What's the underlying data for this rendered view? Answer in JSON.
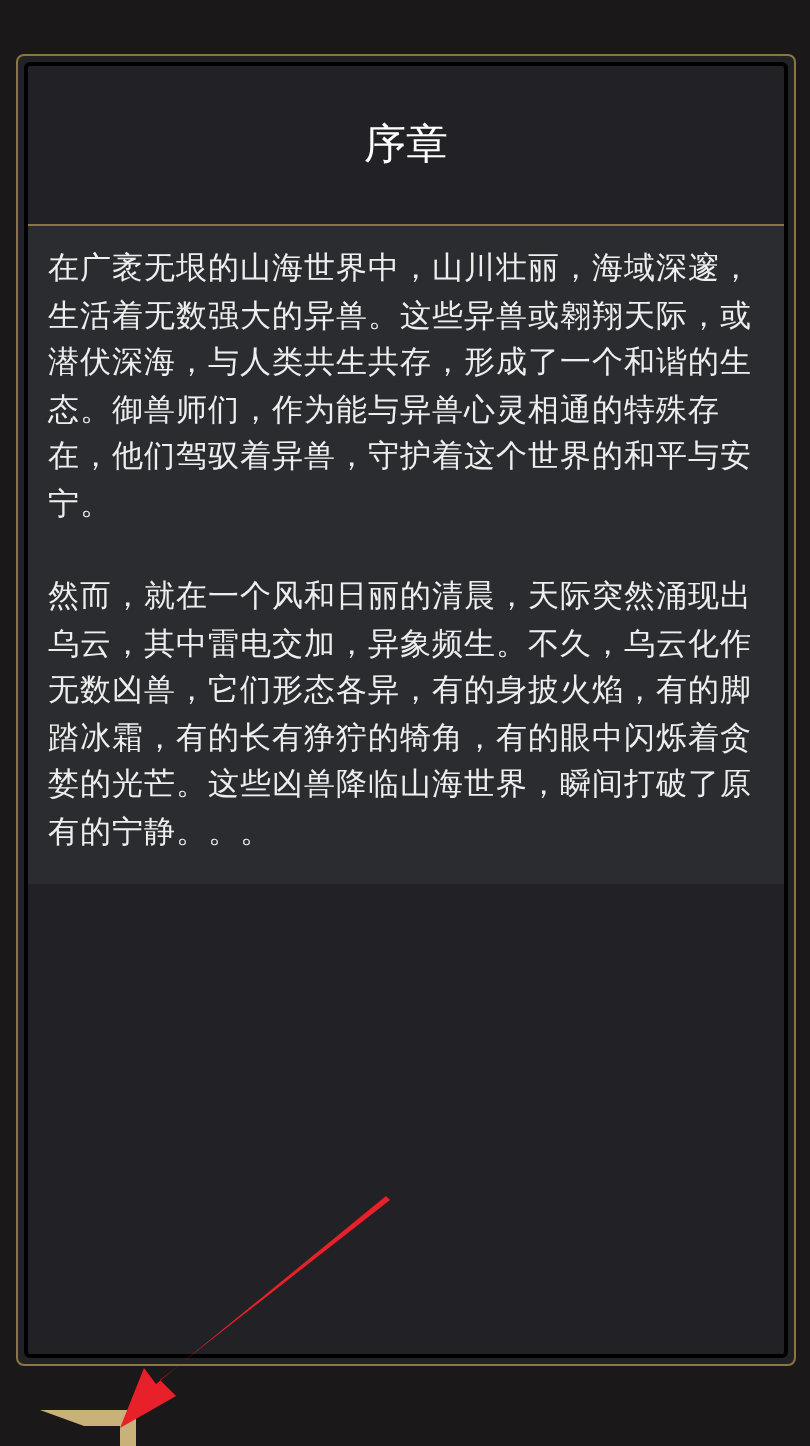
{
  "dialog": {
    "title": "序章",
    "paragraphs": [
      "在广袤无垠的山海世界中，山川壮丽，海域深邃，生活着无数强大的异兽。这些异兽或翱翔天际，或潜伏深海，与人类共生共存，形成了一个和谐的生态。御兽师们，作为能与异兽心灵相通的特殊存在，他们驾驭着异兽，守护着这个世界的和平与安宁。",
      "然而，就在一个风和日丽的清晨，天际突然涌现出乌云，其中雷电交加，异象频生。不久，乌云化作无数凶兽，它们形态各异，有的身披火焰，有的脚踏冰霜，有的长有狰狞的犄角，有的眼中闪烁着贪婪的光芒。这些凶兽降临山海世界，瞬间打破了原有的宁静。。。"
    ]
  }
}
